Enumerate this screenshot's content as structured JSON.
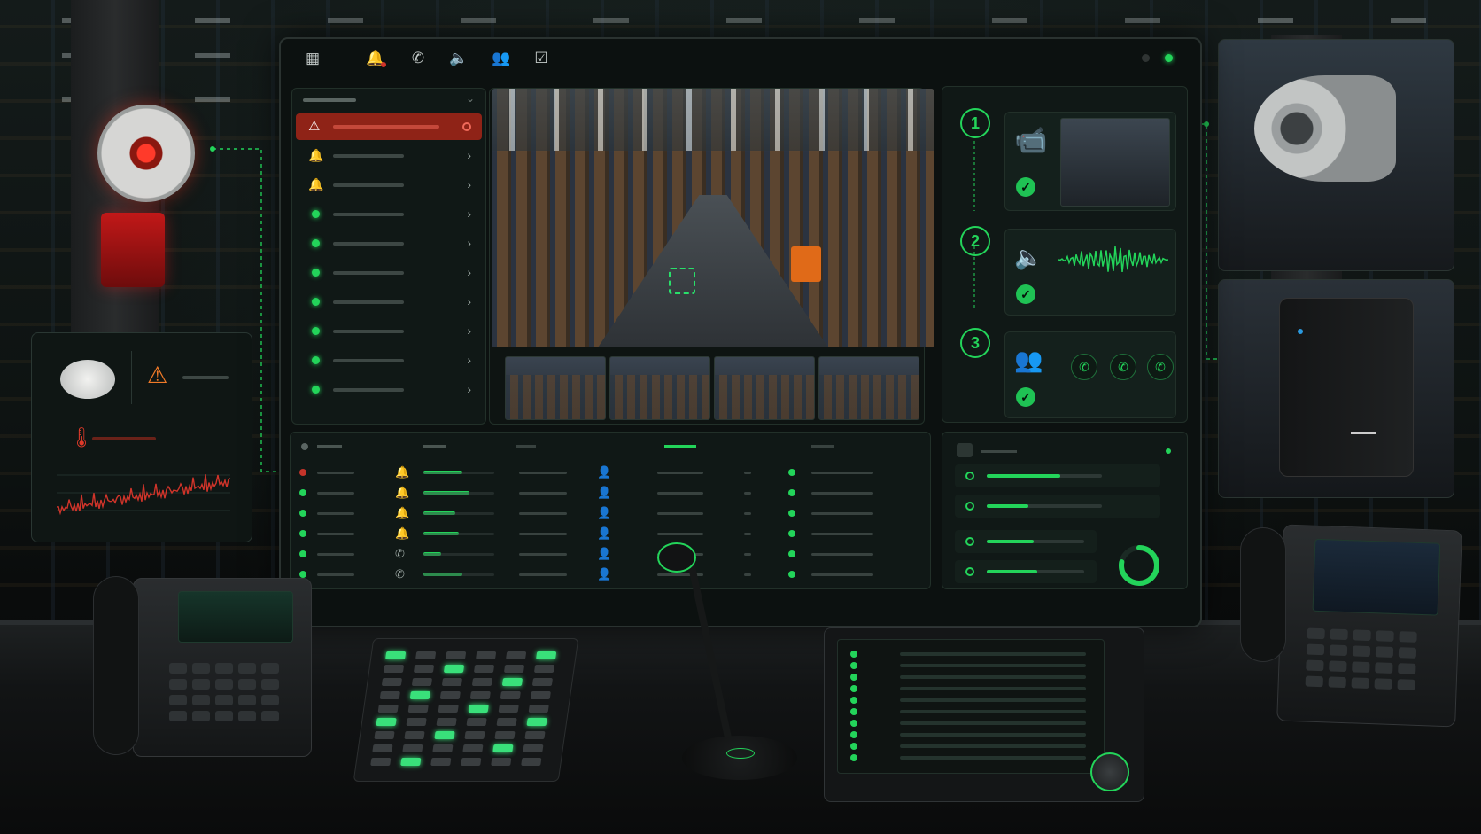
{
  "window": {
    "toolbar_icons": [
      {
        "name": "grid-icon",
        "glyph": "▦"
      },
      {
        "name": "bell-icon",
        "glyph": "🔔"
      },
      {
        "name": "phone-icon",
        "glyph": "✆"
      },
      {
        "name": "speaker-icon",
        "glyph": "🔈"
      },
      {
        "name": "users-icon",
        "glyph": "👥"
      },
      {
        "name": "checklist-icon",
        "glyph": "☑"
      }
    ],
    "status_colors": {
      "idle": "#2f3433",
      "online": "#23d45a"
    }
  },
  "event_list": {
    "rows": [
      {
        "kind": "alert"
      },
      {
        "kind": "bell"
      },
      {
        "kind": "bell"
      },
      {
        "kind": "ok"
      },
      {
        "kind": "ok"
      },
      {
        "kind": "ok"
      },
      {
        "kind": "ok"
      },
      {
        "kind": "ok"
      },
      {
        "kind": "ok"
      },
      {
        "kind": "ok"
      }
    ]
  },
  "workflow": {
    "steps": [
      {
        "number": "1",
        "icon": "camera-icon",
        "status": "done"
      },
      {
        "number": "2",
        "icon": "speaker-icon",
        "status": "done"
      },
      {
        "number": "3",
        "icon": "users-icon",
        "status": "done"
      }
    ]
  },
  "log_table": {
    "rows": [
      {
        "status": "alert",
        "icon": "bell",
        "progress": 0.55
      },
      {
        "status": "ok",
        "icon": "bell",
        "progress": 0.65
      },
      {
        "status": "ok",
        "icon": "bell",
        "progress": 0.45
      },
      {
        "status": "ok",
        "icon": "bell",
        "progress": 0.5
      },
      {
        "status": "ok",
        "icon": "phone",
        "progress": 0.25
      },
      {
        "status": "ok",
        "icon": "phone",
        "progress": 0.55
      }
    ]
  },
  "status_panel": {
    "bars": [
      0.64,
      0.36,
      0.48,
      0.52
    ],
    "donut_fill": 0.78
  },
  "colors": {
    "accent": "#23d45a",
    "alert": "#c4342a",
    "panel": "#101816"
  }
}
